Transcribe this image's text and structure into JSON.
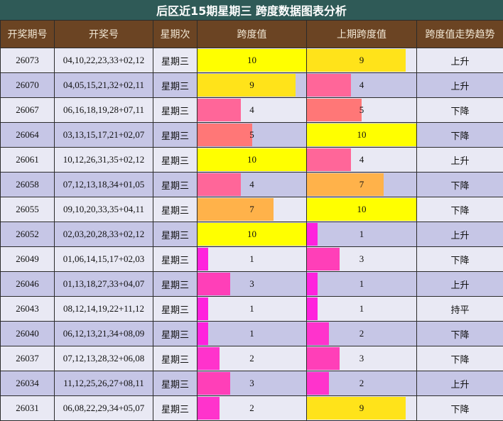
{
  "title": "后区近15期星期三 跨度数据图表分析",
  "headers": [
    "开奖期号",
    "开奖号",
    "星期次",
    "跨度值",
    "上期跨度值",
    "跨度值走势趋势"
  ],
  "chart_data": {
    "type": "table",
    "max_value": 10,
    "rows": [
      {
        "issue": "26073",
        "numbers": "04,10,22,23,33+02,12",
        "weekday": "星期三",
        "span": 10,
        "prev_span": 9,
        "trend": "上升"
      },
      {
        "issue": "26070",
        "numbers": "04,05,15,21,32+02,11",
        "weekday": "星期三",
        "span": 9,
        "prev_span": 4,
        "trend": "上升"
      },
      {
        "issue": "26067",
        "numbers": "06,16,18,19,28+07,11",
        "weekday": "星期三",
        "span": 4,
        "prev_span": 5,
        "trend": "下降"
      },
      {
        "issue": "26064",
        "numbers": "03,13,15,17,21+02,07",
        "weekday": "星期三",
        "span": 5,
        "prev_span": 10,
        "trend": "下降"
      },
      {
        "issue": "26061",
        "numbers": "10,12,26,31,35+02,12",
        "weekday": "星期三",
        "span": 10,
        "prev_span": 4,
        "trend": "上升"
      },
      {
        "issue": "26058",
        "numbers": "07,12,13,18,34+01,05",
        "weekday": "星期三",
        "span": 4,
        "prev_span": 7,
        "trend": "下降"
      },
      {
        "issue": "26055",
        "numbers": "09,10,20,33,35+04,11",
        "weekday": "星期三",
        "span": 7,
        "prev_span": 10,
        "trend": "下降"
      },
      {
        "issue": "26052",
        "numbers": "02,03,20,28,33+02,12",
        "weekday": "星期三",
        "span": 10,
        "prev_span": 1,
        "trend": "上升"
      },
      {
        "issue": "26049",
        "numbers": "01,06,14,15,17+02,03",
        "weekday": "星期三",
        "span": 1,
        "prev_span": 3,
        "trend": "下降"
      },
      {
        "issue": "26046",
        "numbers": "01,13,18,27,33+04,07",
        "weekday": "星期三",
        "span": 3,
        "prev_span": 1,
        "trend": "上升"
      },
      {
        "issue": "26043",
        "numbers": "08,12,14,19,22+11,12",
        "weekday": "星期三",
        "span": 1,
        "prev_span": 1,
        "trend": "持平"
      },
      {
        "issue": "26040",
        "numbers": "06,12,13,21,34+08,09",
        "weekday": "星期三",
        "span": 1,
        "prev_span": 2,
        "trend": "下降"
      },
      {
        "issue": "26037",
        "numbers": "07,12,13,28,32+06,08",
        "weekday": "星期三",
        "span": 2,
        "prev_span": 3,
        "trend": "下降"
      },
      {
        "issue": "26034",
        "numbers": "11,12,25,26,27+08,11",
        "weekday": "星期三",
        "span": 3,
        "prev_span": 2,
        "trend": "上升"
      },
      {
        "issue": "26031",
        "numbers": "06,08,22,29,34+05,07",
        "weekday": "星期三",
        "span": 2,
        "prev_span": 9,
        "trend": "下降"
      }
    ]
  },
  "value_colors": {
    "1": "#ff22dd",
    "2": "#ff33cc",
    "3": "#ff3fb8",
    "4": "#ff6699",
    "5": "#ff7777",
    "7": "#ffb24a",
    "9": "#ffe31a",
    "10": "#ffff00"
  }
}
